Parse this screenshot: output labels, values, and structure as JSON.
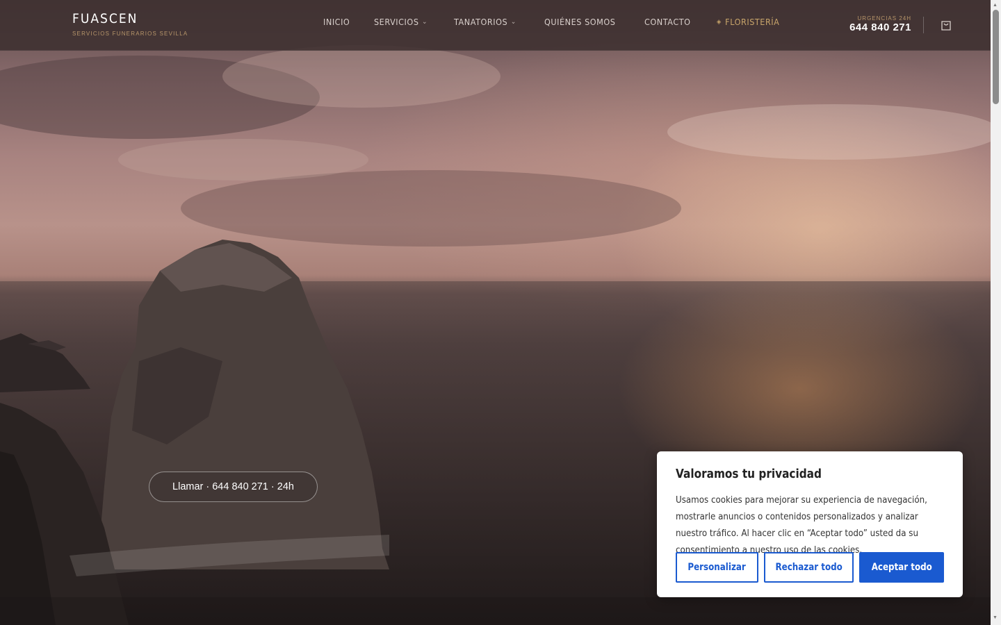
{
  "header": {
    "logo_title": "FUASCEN",
    "logo_subtitle": "SERVICIOS FUNERARIOS SEVILLA",
    "nav": [
      {
        "label": "INICIO",
        "dropdown": false
      },
      {
        "label": "SERVICIOS",
        "dropdown": true
      },
      {
        "label": "TANATORIOS",
        "dropdown": true
      },
      {
        "label": "QUIÉNES SOMOS",
        "dropdown": false
      },
      {
        "label": "CONTACTO",
        "dropdown": false
      },
      {
        "label": "FLORISTERÍA",
        "dropdown": false
      }
    ],
    "urgencias_label": "URGENCIAS 24H",
    "phone": "644 840 271"
  },
  "hero": {
    "call_button": "Llamar · 644 840 271 · 24h"
  },
  "cookie_banner": {
    "title": "Valoramos tu privacidad",
    "text": "Usamos cookies para mejorar su experiencia de navegación, mostrarle anuncios o contenidos personalizados y analizar nuestro tráfico. Al hacer clic en “Aceptar todo” usted da su consentimiento a nuestro uso de las cookies.",
    "customize": "Personalizar",
    "reject": "Rechazar todo",
    "accept": "Aceptar todo"
  },
  "colors": {
    "accent_gold": "#c9a66b",
    "button_blue": "#1a5ad0"
  },
  "icons": {
    "cart": "shopping-bag-icon",
    "chevron": "chevron-down-icon",
    "floristeria": "diamond-icon"
  }
}
